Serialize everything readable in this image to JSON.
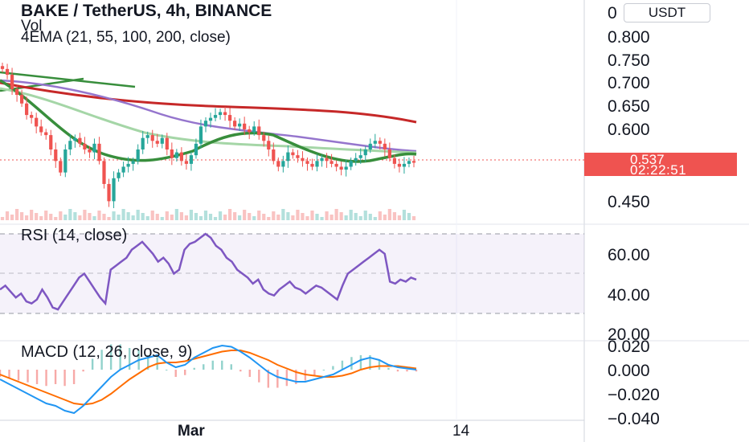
{
  "header": {
    "title": "BAKE / TetherUS, 4h, BINANCE",
    "vol_label": "Vol",
    "ema_label": "4EMA (21, 55, 100, 200, close)"
  },
  "price_axis": {
    "currency_button": "USDT",
    "ticks": [
      "0.800",
      "0.750",
      "0.700",
      "0.650",
      "0.600",
      "0.450"
    ],
    "top_partial": "0",
    "current_price": "0.537",
    "countdown": "02:22:51"
  },
  "rsi_pane": {
    "title": "RSI (14, close)",
    "ticks": [
      "60.00",
      "40.00",
      "20.00"
    ]
  },
  "macd_pane": {
    "title": "MACD (12, 26, close, 9)",
    "ticks": [
      "0.020",
      "0.000",
      "−0.020",
      "−0.040"
    ]
  },
  "time_axis": {
    "labels": [
      "Mar",
      "14"
    ]
  },
  "colors": {
    "up": "#26a69a",
    "down": "#ef5350",
    "ema21": "#388e3c",
    "ema55": "#a5d6a7",
    "ema100": "#9575cd",
    "ema200": "#c62828",
    "rsi": "#7e57c2",
    "macd": "#2196f3",
    "signal": "#ff6d00"
  },
  "chart_data": {
    "type": "line",
    "candles_close": [
      0.7,
      0.69,
      0.665,
      0.655,
      0.64,
      0.62,
      0.615,
      0.6,
      0.59,
      0.585,
      0.56,
      0.54,
      0.52,
      0.56,
      0.575,
      0.58,
      0.57,
      0.56,
      0.555,
      0.57,
      0.54,
      0.5,
      0.47,
      0.51,
      0.52,
      0.53,
      0.535,
      0.54,
      0.56,
      0.58,
      0.585,
      0.575,
      0.57,
      0.58,
      0.56,
      0.545,
      0.555,
      0.54,
      0.535,
      0.55,
      0.57,
      0.6,
      0.61,
      0.615,
      0.62,
      0.625,
      0.62,
      0.61,
      0.6,
      0.605,
      0.595,
      0.59,
      0.6,
      0.585,
      0.575,
      0.56,
      0.54,
      0.53,
      0.54,
      0.555,
      0.55,
      0.545,
      0.54,
      0.535,
      0.53,
      0.54,
      0.545,
      0.54,
      0.535,
      0.53,
      0.525,
      0.53,
      0.54,
      0.545,
      0.55,
      0.56,
      0.57,
      0.575,
      0.57,
      0.56,
      0.545,
      0.535,
      0.53,
      0.535,
      0.54,
      0.537
    ],
    "rsi": [
      42,
      44,
      41,
      38,
      40,
      36,
      35,
      37,
      42,
      38,
      33,
      32,
      36,
      40,
      44,
      48,
      50,
      46,
      42,
      38,
      35,
      52,
      54,
      56,
      58,
      62,
      64,
      66,
      63,
      60,
      56,
      58,
      55,
      50,
      52,
      62,
      65,
      66,
      68,
      70,
      68,
      64,
      62,
      58,
      56,
      52,
      50,
      48,
      45,
      47,
      42,
      40,
      39,
      42,
      44,
      46,
      43,
      42,
      40,
      42,
      44,
      43,
      41,
      39,
      37,
      44,
      50,
      52,
      54,
      56,
      58,
      60,
      62,
      60,
      46,
      45,
      47,
      46,
      48,
      47
    ],
    "macd": [
      -0.008,
      -0.012,
      -0.016,
      -0.02,
      -0.024,
      -0.028,
      -0.03,
      -0.034,
      -0.036,
      -0.03,
      -0.022,
      -0.014,
      -0.006,
      0.0,
      0.004,
      0.008,
      0.01,
      0.012,
      0.006,
      0.002,
      0.004,
      0.01,
      0.014,
      0.018,
      0.02,
      0.019,
      0.015,
      0.01,
      0.004,
      -0.002,
      -0.006,
      -0.008,
      -0.01,
      -0.01,
      -0.008,
      -0.006,
      -0.004,
      0.0,
      0.004,
      0.008,
      0.01,
      0.008,
      0.004,
      0.002,
      0.001,
      0.0
    ],
    "signal": [
      -0.004,
      -0.007,
      -0.01,
      -0.013,
      -0.016,
      -0.019,
      -0.022,
      -0.025,
      -0.028,
      -0.029,
      -0.028,
      -0.025,
      -0.02,
      -0.014,
      -0.008,
      -0.003,
      0.002,
      0.005,
      0.006,
      0.006,
      0.007,
      0.009,
      0.011,
      0.013,
      0.015,
      0.016,
      0.016,
      0.014,
      0.011,
      0.008,
      0.004,
      0.001,
      -0.002,
      -0.004,
      -0.005,
      -0.006,
      -0.006,
      -0.005,
      -0.003,
      0.0,
      0.002,
      0.003,
      0.003,
      0.003,
      0.002,
      0.001
    ],
    "ylim_price": [
      0.43,
      0.82
    ],
    "ylim_rsi": [
      15,
      75
    ],
    "ylim_macd": [
      -0.045,
      0.025
    ]
  }
}
